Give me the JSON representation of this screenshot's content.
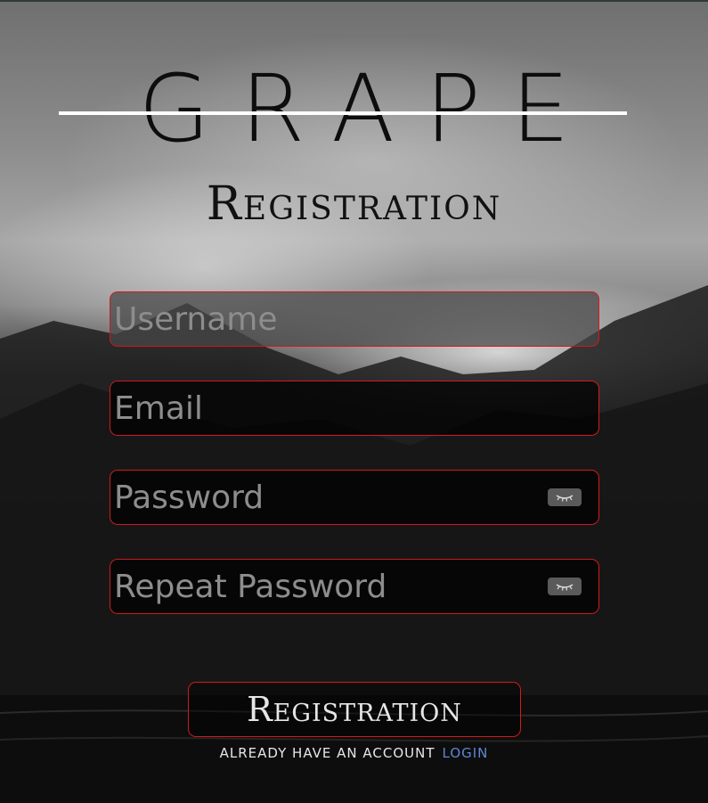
{
  "logo": {
    "text": "GRAPE"
  },
  "page": {
    "title": "Registration"
  },
  "form": {
    "username_placeholder": "Username",
    "email_placeholder": "Email",
    "password_placeholder": "Password",
    "repeat_password_placeholder": "Repeat Password",
    "password_toggle_icon": "eye-closed-icon",
    "submit_label": "Registration"
  },
  "footer": {
    "prompt": "ALREADY HAVE AN ACCOUNT",
    "login_label": "LOGIN"
  },
  "colors": {
    "field_border": "#cf1b1b",
    "link": "#5f86d6",
    "logo_strike": "#ffffff"
  }
}
